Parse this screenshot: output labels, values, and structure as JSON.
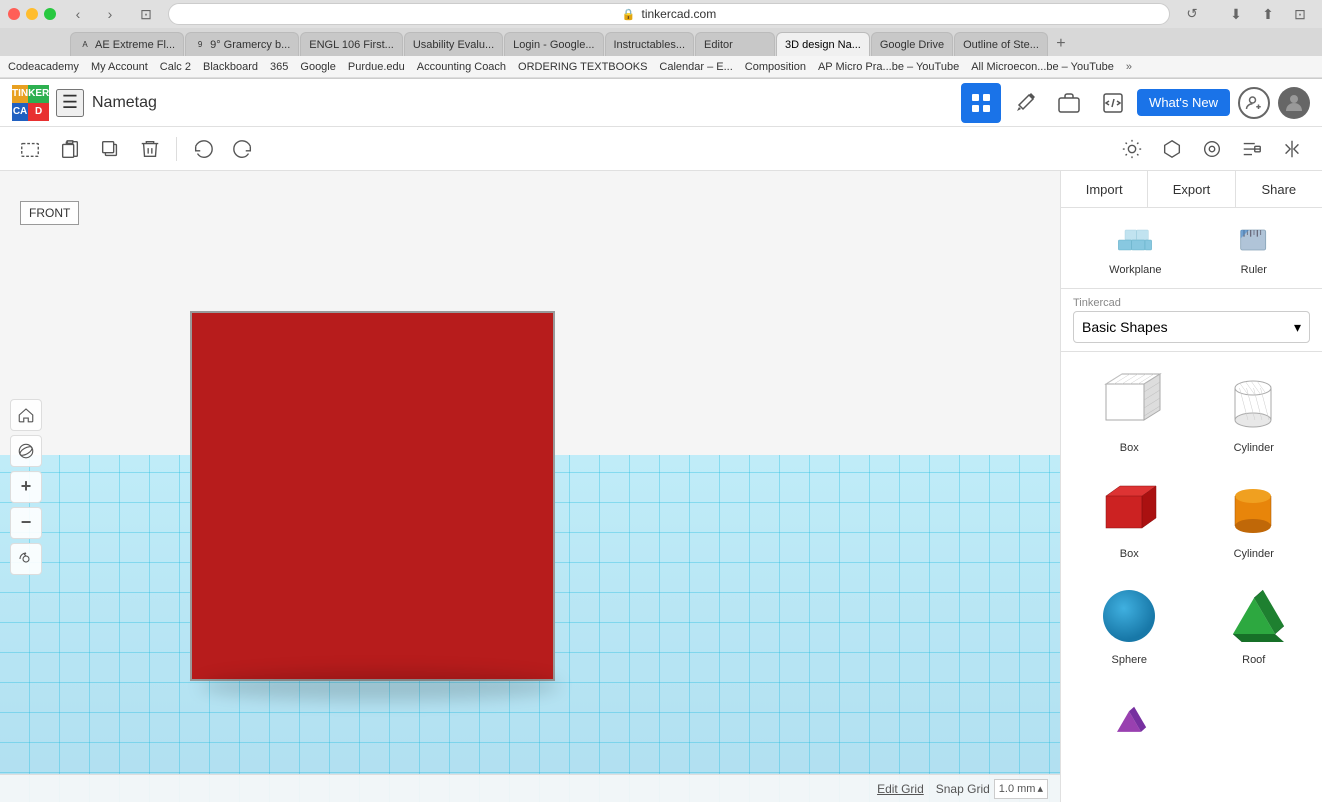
{
  "browser": {
    "address": "tinkercad.com",
    "tabs": [
      {
        "label": "AE Extreme Fl...",
        "active": false
      },
      {
        "label": "9° Gramercy b...",
        "active": false
      },
      {
        "label": "ENGL 106 First...",
        "active": false
      },
      {
        "label": "Usability Evalu...",
        "active": false
      },
      {
        "label": "Login - Google...",
        "active": false
      },
      {
        "label": "Instructables...",
        "active": false
      },
      {
        "label": "Editor",
        "active": false
      },
      {
        "label": "3D design Na...",
        "active": true
      },
      {
        "label": "Google Drive",
        "active": false
      },
      {
        "label": "Outline of Ste...",
        "active": false
      }
    ],
    "bookmarks": [
      "Codeacademy",
      "My Account",
      "Calc 2",
      "Blackboard",
      "365",
      "Google",
      "Purdue.edu",
      "Accounting Coach",
      "ORDERING TEXTBOOKS",
      "Calendar – E...",
      "Composition",
      "AP Micro Pra...be – YouTube",
      "All Microecon...be – YouTube",
      "»"
    ]
  },
  "header": {
    "project_name": "Nametag",
    "whats_new": "What's New"
  },
  "toolbar": {
    "new_workplane": "New workplane",
    "paste": "Paste",
    "duplicate": "Duplicate",
    "delete": "Delete",
    "undo": "Undo",
    "redo": "Redo"
  },
  "panel": {
    "import_label": "Import",
    "export_label": "Export",
    "share_label": "Share",
    "workplane_label": "Workplane",
    "ruler_label": "Ruler",
    "library_provider": "Tinkercad",
    "library_name": "Basic Shapes",
    "shapes": [
      {
        "name": "Box",
        "type": "box-wire"
      },
      {
        "name": "Cylinder",
        "type": "cylinder-wire"
      },
      {
        "name": "Box",
        "type": "box-solid"
      },
      {
        "name": "Cylinder",
        "type": "cylinder-solid"
      },
      {
        "name": "Sphere",
        "type": "sphere-solid"
      },
      {
        "name": "Roof",
        "type": "roof-solid"
      }
    ]
  },
  "viewport": {
    "front_label": "FRONT",
    "edit_grid": "Edit Grid",
    "snap_grid": "Snap Grid",
    "snap_value": "1.0 mm"
  },
  "icons": {
    "grid": "⊞",
    "pickaxe": "⛏",
    "briefcase": "💼",
    "code_bracket": "{ }",
    "chevron_right": "❯",
    "home": "⌂",
    "target": "◎",
    "plus": "+",
    "minus": "−",
    "reset": "↺",
    "hamburger": "☰",
    "new_shape": "☐",
    "paste_icon": "📋",
    "duplicate_icon": "⧉",
    "delete_icon": "🗑",
    "undo_icon": "↩",
    "redo_icon": "↪",
    "light_icon": "☀",
    "pentagon_icon": "⬠",
    "circle_icon": "○",
    "align_icon": "⊞",
    "mirror_icon": "◫",
    "chevron_down": "▾"
  }
}
